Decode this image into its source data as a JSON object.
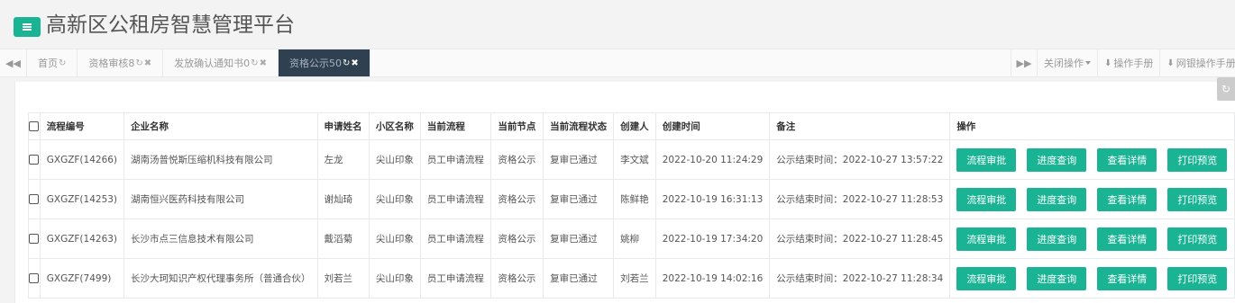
{
  "app": {
    "title": "高新区公租房智慧管理平台"
  },
  "colors": {
    "accent": "#1ab394",
    "active_tab": "#2f4050"
  },
  "tabs": [
    {
      "label": "首页",
      "icons": [
        "refresh-icon"
      ]
    },
    {
      "label": "资格审核8",
      "icons": [
        "refresh-icon",
        "close-icon"
      ]
    },
    {
      "label": "发放确认通知书0",
      "icons": [
        "refresh-icon",
        "close-icon"
      ]
    },
    {
      "label": "资格公示50",
      "icons": [
        "refresh-icon",
        "close-icon"
      ],
      "active": true
    }
  ],
  "toolbar": {
    "close_ops": "关闭操作",
    "manual": "操作手册",
    "bank_manual": "网银操作手册"
  },
  "table": {
    "headers": [
      "流程编号",
      "企业名称",
      "申请姓名",
      "小区名称",
      "当前流程",
      "当前节点",
      "当前流程状态",
      "创建人",
      "创建时间",
      "备注",
      "操作"
    ],
    "actions": [
      "流程审批",
      "进度查询",
      "查看详情",
      "打印预览"
    ],
    "rows": [
      [
        "GXGZF(14266)",
        "湖南汤普悦斯压缩机科技有限公司",
        "左龙",
        "尖山印象",
        "员工申请流程",
        "资格公示",
        "复审已通过",
        "李文斌",
        "2022-10-20 11:24:29",
        "公示结束时间：2022-10-27 13:57:22"
      ],
      [
        "GXGZF(14253)",
        "湖南恒兴医药科技有限公司",
        "谢灿琦",
        "尖山印象",
        "员工申请流程",
        "资格公示",
        "复审已通过",
        "陈鲜艳",
        "2022-10-19 16:31:13",
        "公示结束时间：2022-10-27 11:28:53"
      ],
      [
        "GXGZF(14263)",
        "长沙市点三信息技术有限公司",
        "戴滔菊",
        "尖山印象",
        "员工申请流程",
        "资格公示",
        "复审已通过",
        "姚柳",
        "2022-10-19 17:34:20",
        "公示结束时间：2022-10-27 11:28:45"
      ],
      [
        "GXGZF(7499)",
        "长沙大珂知识产权代理事务所（普通合伙）",
        "刘若兰",
        "尖山印象",
        "员工申请流程",
        "资格公示",
        "复审已通过",
        "刘若兰",
        "2022-10-19 14:02:16",
        "公示结束时间：2022-10-27 11:28:34"
      ]
    ]
  }
}
